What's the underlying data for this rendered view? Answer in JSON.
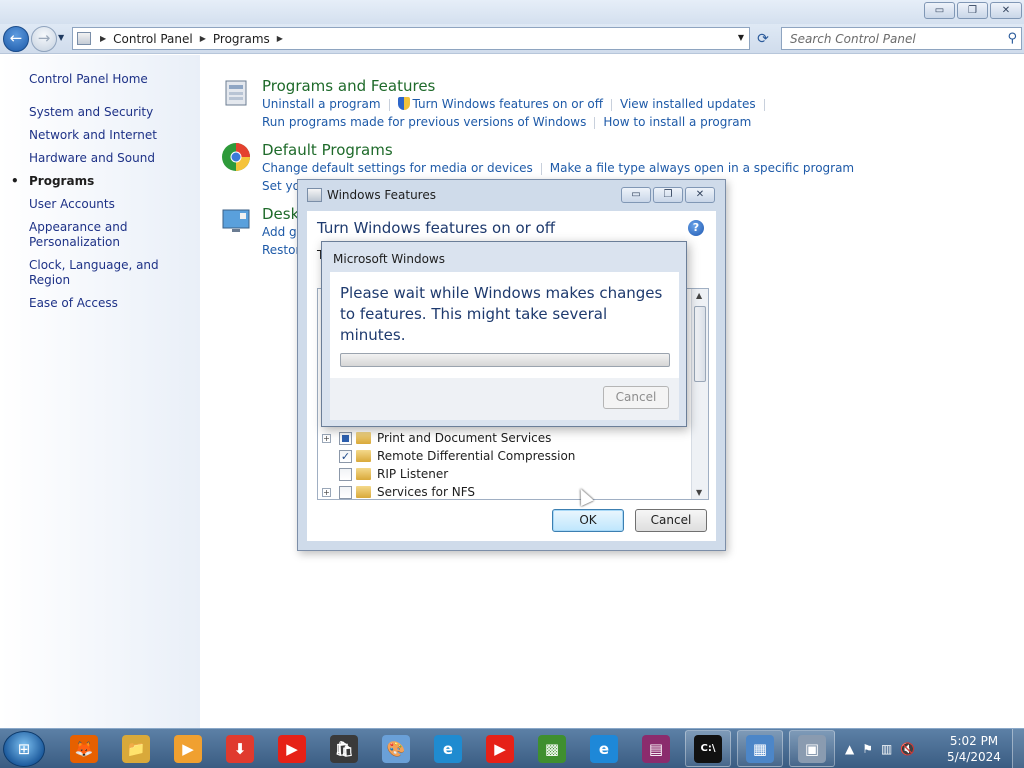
{
  "window": {
    "minimize_glyph": "▭",
    "maximize_glyph": "❐",
    "close_glyph": "✕"
  },
  "address_bar": {
    "back_glyph": "←",
    "forward_glyph": "→",
    "crumbs": [
      "Control Panel",
      "Programs"
    ],
    "search_placeholder": "Search Control Panel"
  },
  "sidebar": {
    "home": "Control Panel Home",
    "items": [
      {
        "label": "System and Security"
      },
      {
        "label": "Network and Internet"
      },
      {
        "label": "Hardware and Sound"
      },
      {
        "label": "Programs"
      },
      {
        "label": "User Accounts"
      },
      {
        "label": "Appearance and Personalization"
      },
      {
        "label": "Clock, Language, and Region"
      },
      {
        "label": "Ease of Access"
      }
    ]
  },
  "sections": {
    "programs_features": {
      "title": "Programs and Features",
      "links": [
        "Uninstall a program",
        "Turn Windows features on or off",
        "View installed updates",
        "Run programs made for previous versions of Windows",
        "How to install a program"
      ]
    },
    "default_programs": {
      "title": "Default Programs",
      "links": [
        "Change default settings for media or devices",
        "Make a file type always open in a specific program",
        "Set you"
      ]
    },
    "desktop_gadgets": {
      "title": "Desk",
      "links": [
        "Add ga",
        "Restore"
      ]
    }
  },
  "windows_features": {
    "title": "Windows Features",
    "heading": "Turn Windows features on or off",
    "help": "?",
    "partial_text": "T",
    "tree": [
      {
        "label": "Print and Document Services",
        "state": "partial",
        "expandable": true
      },
      {
        "label": "Remote Differential Compression",
        "state": "checked",
        "expandable": false
      },
      {
        "label": "RIP Listener",
        "state": "unchecked",
        "expandable": false
      },
      {
        "label": "Services for NFS",
        "state": "unchecked",
        "expandable": true
      }
    ],
    "ok": "OK",
    "cancel": "Cancel"
  },
  "progress_dialog": {
    "title": "Microsoft Windows",
    "message": "Please wait while Windows makes changes to features. This might take several minutes.",
    "progress": 0,
    "cancel": "Cancel"
  },
  "taskbar": {
    "start_glyph": "⊞",
    "apps": [
      {
        "name": "firefox",
        "glyph": "🦊",
        "color": "#e66000"
      },
      {
        "name": "file-explorer",
        "glyph": "📁",
        "color": "#d9a93a"
      },
      {
        "name": "media-player",
        "glyph": "▶",
        "color": "#f0a030"
      },
      {
        "name": "download-manager",
        "glyph": "⬇",
        "color": "#e03a2e"
      },
      {
        "name": "youtube",
        "glyph": "▶",
        "color": "#e62117"
      },
      {
        "name": "store",
        "glyph": "🛍",
        "color": "#3a3a3a"
      },
      {
        "name": "paint",
        "glyph": "🎨",
        "color": "#6aa0d8"
      },
      {
        "name": "edge",
        "glyph": "e",
        "color": "#1f8bd0"
      },
      {
        "name": "youtube-2",
        "glyph": "▶",
        "color": "#e62117"
      },
      {
        "name": "minecraft",
        "glyph": "▩",
        "color": "#3f8f2f"
      },
      {
        "name": "internet-explorer",
        "glyph": "e",
        "color": "#1e88d8"
      },
      {
        "name": "winrar",
        "glyph": "▤",
        "color": "#8b2c6d"
      },
      {
        "name": "command-prompt",
        "glyph": "C:\\",
        "color": "#111111"
      },
      {
        "name": "control-panel",
        "glyph": "▦",
        "color": "#4c86c8"
      },
      {
        "name": "windows-features",
        "glyph": "▣",
        "color": "#8a9bb0"
      }
    ],
    "tray_glyphs": [
      "▲",
      "⚑",
      "▥",
      "🔇"
    ],
    "time": "5:02 PM",
    "date": "5/4/2024"
  }
}
